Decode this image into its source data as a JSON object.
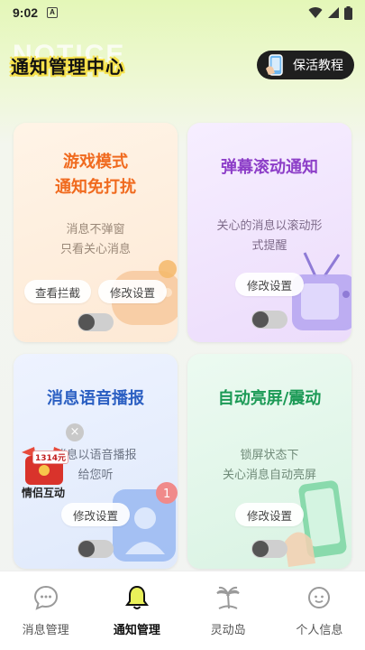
{
  "status_bar": {
    "time": "9:02",
    "notification_badge": "A"
  },
  "header": {
    "bg_text": "NOTICE",
    "title": "通知管理中心",
    "tutorial_button": "保活教程"
  },
  "cards": {
    "game_mode": {
      "title_line1": "游戏模式",
      "title_line2": "通知免打扰",
      "desc_line1": "消息不弹窗",
      "desc_line2": "只看关心消息",
      "button_intercept": "查看拦截",
      "button_settings": "修改设置",
      "toggle_on": false
    },
    "barrage": {
      "title": "弹幕滚动通知",
      "desc_line1": "关心的消息以滚动形",
      "desc_line2": "式提醒",
      "button_settings": "修改设置",
      "toggle_on": false
    },
    "voice": {
      "title": "消息语音播报",
      "desc_line1": "消息以语音播报",
      "desc_line2": "给您听",
      "button_settings": "修改设置",
      "toggle_on": false
    },
    "wake_screen": {
      "title": "自动亮屏/震动",
      "desc_line1": "锁屏状态下",
      "desc_line2": "关心消息自动亮屏",
      "button_settings": "修改设置",
      "toggle_on": false
    }
  },
  "floating_ad": {
    "amount": "1314元",
    "label": "情侣互动",
    "close": "×"
  },
  "tabbar": {
    "active_index": 1,
    "items": [
      {
        "label": "消息管理",
        "icon": "chat-bubble-icon"
      },
      {
        "label": "通知管理",
        "icon": "bell-icon"
      },
      {
        "label": "灵动岛",
        "icon": "palm-tree-icon"
      },
      {
        "label": "个人信息",
        "icon": "face-icon"
      }
    ]
  },
  "colors": {
    "accent_game": "#f06a1e",
    "accent_barrage": "#8d3fc8",
    "accent_voice": "#2b5fc2",
    "accent_wake": "#1c9a56"
  }
}
